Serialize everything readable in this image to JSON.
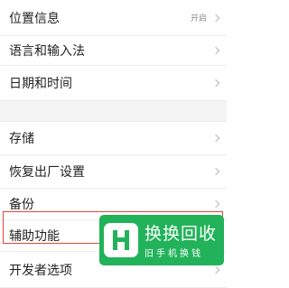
{
  "settings": {
    "group1": [
      {
        "label": "位置信息",
        "value": "开启"
      },
      {
        "label": "语言和输入法",
        "value": ""
      },
      {
        "label": "日期和时间",
        "value": ""
      }
    ],
    "group2": [
      {
        "label": "存储"
      },
      {
        "label": "恢复出厂设置"
      },
      {
        "label": "备份"
      },
      {
        "label": "辅助功能"
      },
      {
        "label": "开发者选项"
      }
    ]
  },
  "watermark": {
    "name": "换换回收",
    "tagline": "旧手机换钱",
    "brand_color": "#22b35a",
    "logo_icon": "h-logo-icon"
  },
  "highlight_color": "#e0463c"
}
